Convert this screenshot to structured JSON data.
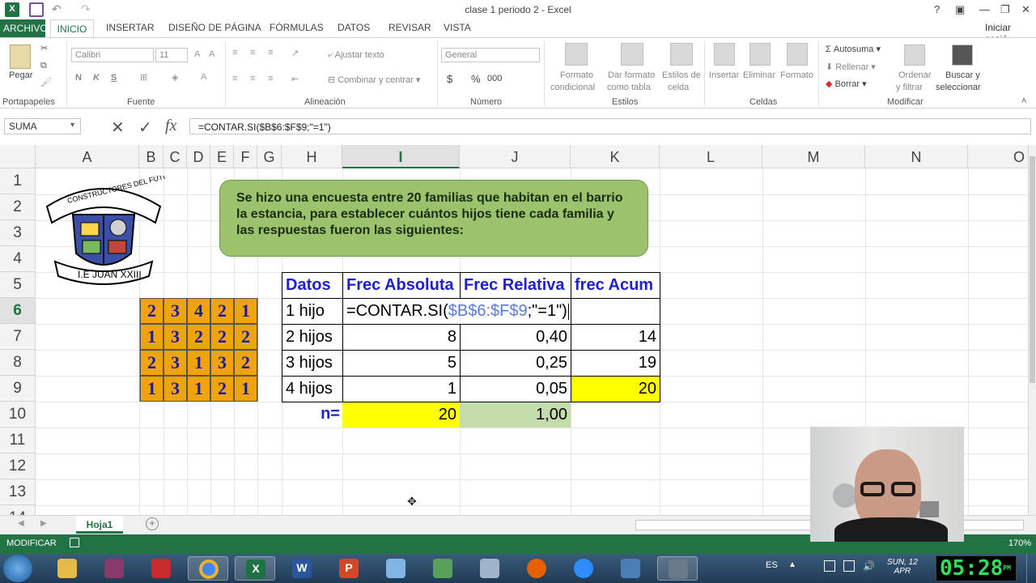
{
  "window": {
    "title": "clase 1 periodo 2 - Excel",
    "help": "?",
    "user": "Iniciar sesió"
  },
  "tabs": {
    "archivo": "ARCHIVO",
    "inicio": "INICIO",
    "insertar": "INSERTAR",
    "diseno": "DISEÑO DE PÁGINA",
    "formulas": "FÓRMULAS",
    "datos": "DATOS",
    "revisar": "REVISAR",
    "vista": "VISTA"
  },
  "ribbon": {
    "portapapeles": {
      "pegar": "Pegar",
      "label": "Portapapeles"
    },
    "fuente": {
      "font": "Calibri",
      "size": "11",
      "bold": "N",
      "italic": "K",
      "underline": "S",
      "label": "Fuente"
    },
    "alineacion": {
      "ajustar": "Ajustar texto",
      "combinar": "Combinar y centrar",
      "label": "Alineación"
    },
    "numero": {
      "format": "General",
      "currency": "$",
      "percent": "%",
      "thousands": "000",
      "label": "Número"
    },
    "estilos": {
      "formato_condicional": "Formato",
      "formato_condicional2": "condicional",
      "dar_formato": "Dar formato",
      "dar_formato2": "como tabla",
      "estilos_celda": "Estilos de",
      "estilos_celda2": "celda",
      "label": "Estilos"
    },
    "celdas": {
      "insertar": "Insertar",
      "eliminar": "Eliminar",
      "formato": "Formato",
      "label": "Celdas"
    },
    "modificar": {
      "autosuma": "Autosuma",
      "rellenar": "Rellenar",
      "borrar": "Borrar",
      "ordenar": "Ordenar",
      "ordenar2": "y filtrar",
      "buscar": "Buscar y",
      "buscar2": "seleccionar",
      "label": "Modificar"
    }
  },
  "formula_bar": {
    "name_box": "SUMA",
    "cancel": "✕",
    "enter": "✓",
    "fx": "fx",
    "formula": "=CONTAR.SI($B$6:$F$9;\"=1\")"
  },
  "columns": [
    "A",
    "B",
    "C",
    "D",
    "E",
    "F",
    "G",
    "H",
    "I",
    "J",
    "K",
    "L",
    "M",
    "N",
    "O"
  ],
  "rows": [
    "1",
    "2",
    "3",
    "4",
    "5",
    "6",
    "7",
    "8",
    "9",
    "10",
    "11",
    "12",
    "13",
    "14"
  ],
  "logo": {
    "top_text": "CONSTRUCTORES DEL FUTURO",
    "banner": "I.E JUAN XXIII"
  },
  "callout": "Se hizo una encuesta entre 20 familias que habitan en el barrio la estancia, para establecer cuántos hijos tiene cada familia y las respuestas fueron las siguientes:",
  "data_grid": [
    [
      "2",
      "3",
      "4",
      "2",
      "1"
    ],
    [
      "1",
      "3",
      "2",
      "2",
      "2"
    ],
    [
      "2",
      "3",
      "1",
      "3",
      "2"
    ],
    [
      "1",
      "3",
      "1",
      "2",
      "1"
    ]
  ],
  "table": {
    "headers": [
      "Datos",
      "Frec Absoluta",
      "Frec Relativa",
      "frec Acum"
    ],
    "rows": [
      {
        "datos": "1 hijo",
        "editing": "=CONTAR.SI(",
        "ref": "$B$6:$F$9",
        "tail": ";\"=1\")"
      },
      {
        "datos": "2 hijos",
        "abs": "8",
        "rel": "0,40",
        "acum": "14"
      },
      {
        "datos": "3 hijos",
        "abs": "5",
        "rel": "0,25",
        "acum": "19"
      },
      {
        "datos": "4 hijos",
        "abs": "1",
        "rel": "0,05",
        "acum": "20"
      }
    ],
    "total_label": "n=",
    "total_abs": "20",
    "total_rel": "1,00"
  },
  "sheet_tab": "Hoja1",
  "status": {
    "mode": "MODIFICAR",
    "zoom": "170%"
  },
  "taskbar": {
    "lang": "ES",
    "day": "SUN, 12",
    "month": "APR",
    "time": "05:28",
    "ampm": "PM"
  },
  "colors": {
    "excel_green": "#217346",
    "accent_yellow": "#ffff00",
    "light_green": "#c4dcab",
    "cell_orange": "#f0a30a",
    "header_blue": "#1f1fcc"
  }
}
